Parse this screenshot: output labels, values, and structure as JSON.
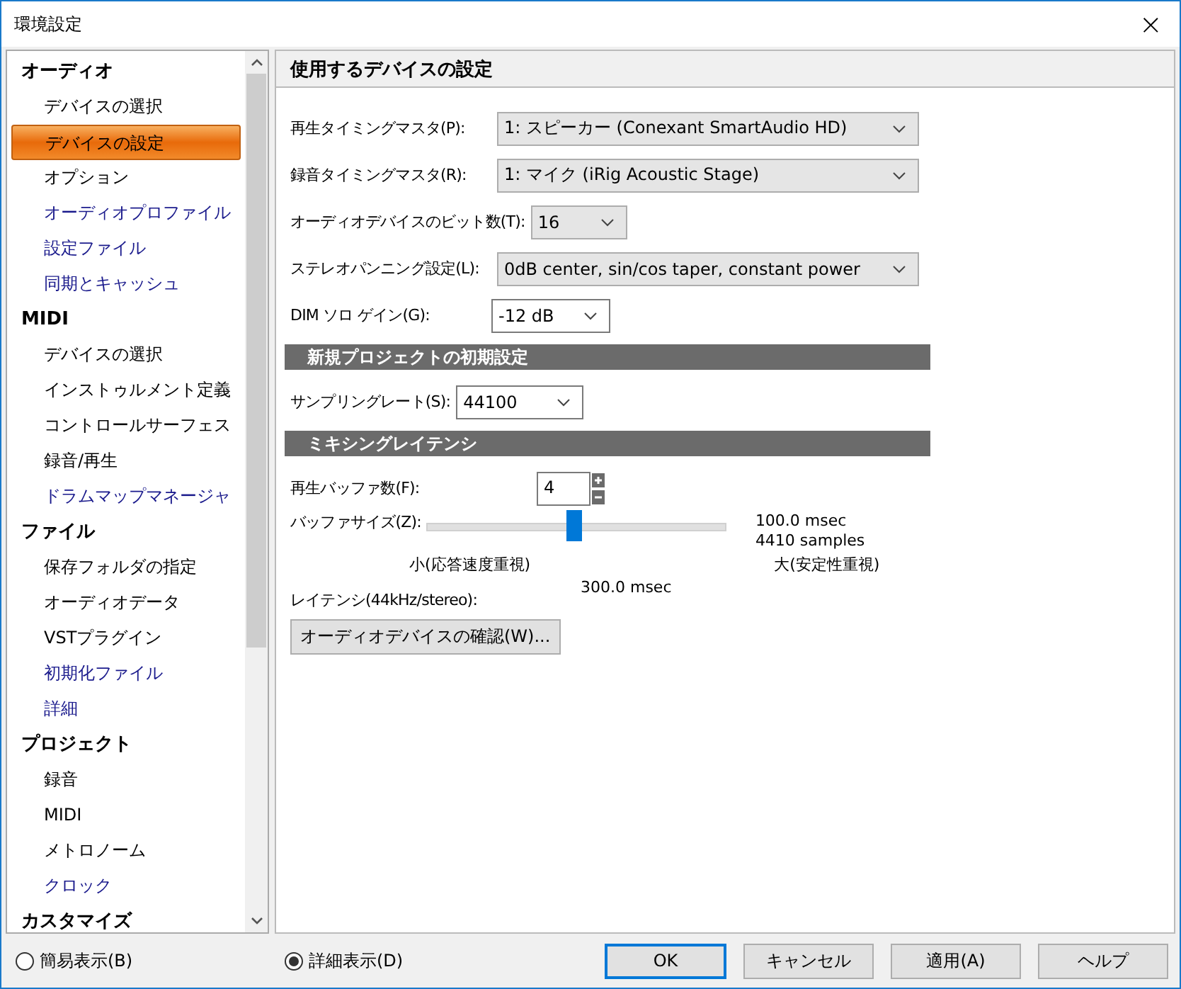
{
  "window": {
    "title": "環境設定",
    "close": "×"
  },
  "sidebar": {
    "groups": [
      {
        "label": "オーディオ",
        "items": [
          {
            "label": "デバイスの選択",
            "selected": false,
            "color": "#000000"
          },
          {
            "label": "デバイスの設定",
            "selected": true
          },
          {
            "label": "オプション",
            "selected": false,
            "color": "#000000"
          },
          {
            "label": "オーディオプロファイル",
            "selected": false,
            "color": "#1a1a8c"
          },
          {
            "label": "設定ファイル",
            "selected": false,
            "color": "#1a1a8c"
          },
          {
            "label": "同期とキャッシュ",
            "selected": false,
            "color": "#1a1a8c"
          }
        ]
      },
      {
        "label": "MIDI",
        "items": [
          {
            "label": "デバイスの選択",
            "selected": false,
            "color": "#000000"
          },
          {
            "label": "インストゥルメント定義",
            "selected": false,
            "color": "#000000"
          },
          {
            "label": "コントロールサーフェス",
            "selected": false,
            "color": "#000000"
          },
          {
            "label": "録音/再生",
            "selected": false,
            "color": "#000000"
          },
          {
            "label": "ドラムマップマネージャ",
            "selected": false,
            "color": "#1a1a8c"
          }
        ]
      },
      {
        "label": "ファイル",
        "items": [
          {
            "label": "保存フォルダの指定",
            "selected": false,
            "color": "#000000"
          },
          {
            "label": "オーディオデータ",
            "selected": false,
            "color": "#000000"
          },
          {
            "label": "VSTプラグイン",
            "selected": false,
            "color": "#000000"
          },
          {
            "label": "初期化ファイル",
            "selected": false,
            "color": "#1a1a8c"
          },
          {
            "label": "詳細",
            "selected": false,
            "color": "#1a1a8c"
          }
        ]
      },
      {
        "label": "プロジェクト",
        "items": [
          {
            "label": "録音",
            "selected": false,
            "color": "#000000"
          },
          {
            "label": "MIDI",
            "selected": false,
            "color": "#000000"
          },
          {
            "label": "メトロノーム",
            "selected": false,
            "color": "#000000"
          },
          {
            "label": "クロック",
            "selected": false,
            "color": "#1a1a8c"
          }
        ]
      },
      {
        "label": "カスタマイズ"
      }
    ]
  },
  "panel": {
    "title": "使用するデバイスの設定",
    "device_fields": [
      {
        "label": "再生タイミングマスタ(P):",
        "value": "1: スピーカー (Conexant SmartAudio HD)"
      },
      {
        "label": "録音タイミングマスタ(R):",
        "value": "1: マイク (iRig Acoustic Stage)"
      },
      {
        "label": "オーディオデバイスのビット数(T):",
        "value": "16"
      },
      {
        "label": "ステレオパンニング設定(L):",
        "value": "0dB center, sin/cos taper, constant power"
      },
      {
        "label": "DIM ソロ ゲイン(G):",
        "value": "-12 dB"
      }
    ],
    "new_project": {
      "title": "新規プロジェクトの初期設定",
      "sampling_label": "サンプリングレート(S):",
      "sampling_value": "44100"
    },
    "latency": {
      "title": "ミキシングレイテンシ",
      "buffers_label": "再生バッファ数(F):",
      "buffers_value": "4",
      "buffer_size_label": "バッファサイズ(Z):",
      "level": 0.49,
      "msec": "100.0 msec",
      "samples": "4410 samples",
      "min_label": "小(応答速度重視)",
      "max_label": "大(安定性重視)",
      "latency_label": "レイテンシ(44kHz/stereo):",
      "latency_value": "300.0 msec"
    },
    "check_button": "オーディオデバイスの確認(W)..."
  },
  "view_modes": [
    {
      "label": "簡易表示(B)",
      "selected": false
    },
    {
      "label": "詳細表示(D)",
      "selected": true
    }
  ],
  "buttons": [
    {
      "label": "OK",
      "default": true
    },
    {
      "label": "キャンセル",
      "default": false
    },
    {
      "label": "適用(A)",
      "default": false
    },
    {
      "label": "ヘルプ",
      "default": false
    }
  ]
}
